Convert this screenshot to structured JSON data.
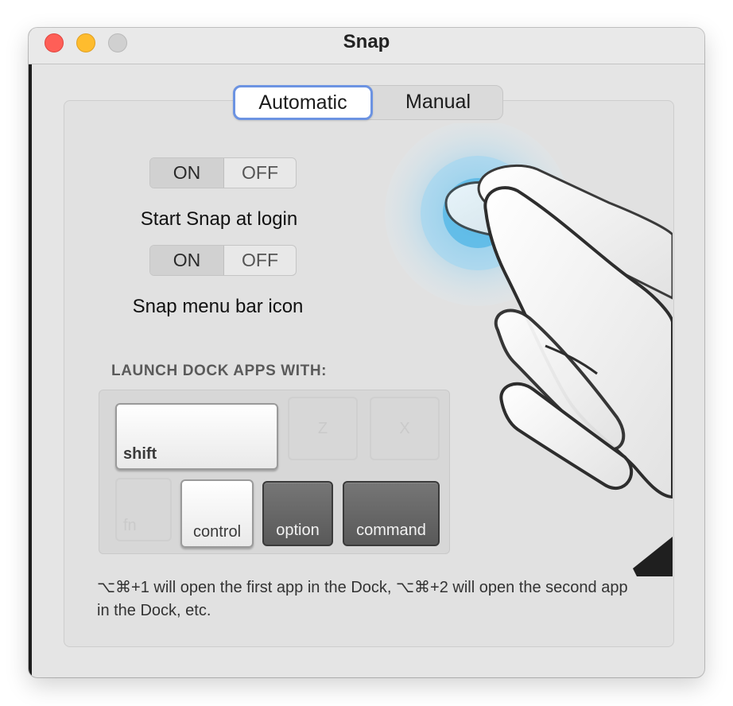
{
  "window": {
    "title": "Snap"
  },
  "tabs": [
    {
      "label": "Automatic",
      "selected": true
    },
    {
      "label": "Manual",
      "selected": false
    }
  ],
  "toggles": [
    {
      "on_label": "ON",
      "off_label": "OFF",
      "state": "ON",
      "caption": "Start Snap at login"
    },
    {
      "on_label": "ON",
      "off_label": "OFF",
      "state": "ON",
      "caption": "Snap menu bar icon"
    }
  ],
  "launch": {
    "heading": "LAUNCH DOCK APPS WITH:",
    "keys": {
      "shift": "shift",
      "z": "Z",
      "x": "X",
      "fn": "fn",
      "control": "control",
      "option": "option",
      "command": "command"
    }
  },
  "footnote": "⌥⌘+1 will open the first app in the Dock, ⌥⌘+2 will open the second app in the Dock, etc.",
  "colors": {
    "accent": "#6c93e2",
    "close": "#fe5f57",
    "minimize": "#febc2e",
    "zoom_disabled": "#d0d0d0"
  }
}
